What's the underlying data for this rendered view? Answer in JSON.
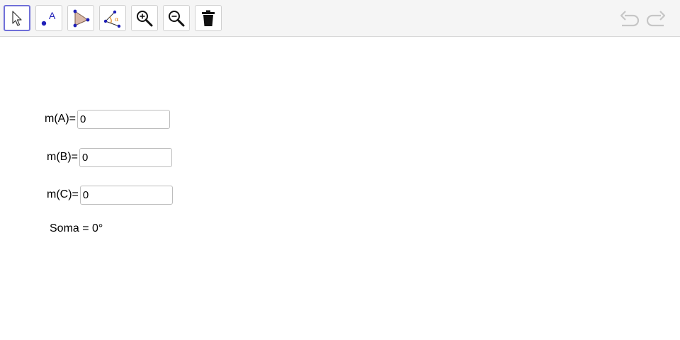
{
  "toolbar": {
    "tools": [
      {
        "name": "move-tool",
        "icon": "arrow-cursor-icon",
        "active": true
      },
      {
        "name": "point-tool",
        "icon": "point-icon",
        "label": "A"
      },
      {
        "name": "polygon-tool",
        "icon": "triangle-icon"
      },
      {
        "name": "angle-tool",
        "icon": "angle-icon",
        "label": "α"
      },
      {
        "name": "zoom-in-tool",
        "icon": "zoom-in-icon"
      },
      {
        "name": "zoom-out-tool",
        "icon": "zoom-out-icon"
      },
      {
        "name": "delete-tool",
        "icon": "trash-icon"
      }
    ],
    "undo_icon": "undo-icon",
    "redo_icon": "redo-icon"
  },
  "colors": {
    "active_border": "#6f6fd8",
    "point_blue": "#1f1fb8",
    "triangle_fill": "#d9b9a8",
    "angle_orange": "#e07a00"
  },
  "inputs": {
    "a": {
      "label": "m(A)=",
      "value": "0"
    },
    "b": {
      "label": "m(B)=",
      "value": "0"
    },
    "c": {
      "label": "m(C)=",
      "value": "0"
    }
  },
  "soma": "Soma = 0°"
}
